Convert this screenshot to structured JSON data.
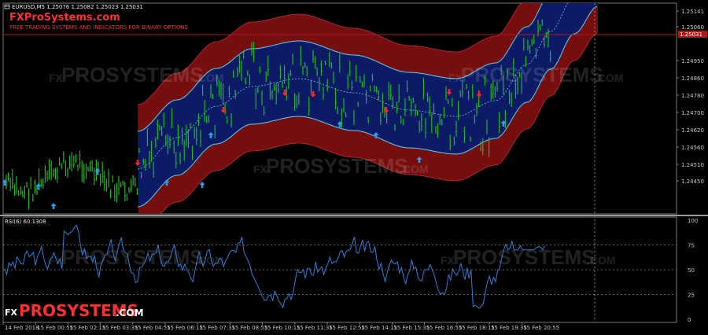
{
  "main_chart": {
    "symbol_info": "EURUSD,M5  1.25076 1.25082 1.25023 1.25031",
    "price_axis": [
      "1.25141",
      "1.25060",
      "1.24950",
      "1.24860",
      "1.24780",
      "1.24700",
      "1.24620",
      "1.24560",
      "1.24510",
      "1.24450"
    ],
    "current_price": "1.25031",
    "brand_title": "FXProSystems.com",
    "brand_subtitle": "FREE TRADING SYSTEMS AND INDICATORS FOR BINARY OPTIONS",
    "watermark_small": "FX",
    "watermark_big": "PROSYSTEMS",
    "watermark_suffix": ".COM"
  },
  "rsi_panel": {
    "label": "RSI(6) 60.1308",
    "levels": [
      "100",
      "75",
      "50",
      "25",
      "0"
    ]
  },
  "time_axis": [
    "14 Feb 2018",
    "15 Feb 00:55",
    "15 Feb 02:15",
    "15 Feb 03:35",
    "15 Feb 04:55",
    "15 Feb 06:15",
    "15 Feb 07:35",
    "15 Feb 08:55",
    "15 Feb 10:15",
    "15 Feb 11:35",
    "15 Feb 12:55",
    "15 Feb 14:15",
    "15 Feb 15:35",
    "15 Feb 16:55",
    "15 Feb 18:15",
    "15 Feb 19:35",
    "15 Feb 20:55"
  ],
  "footer_logo": {
    "fx": "FX",
    "main": "PROSYSTEMS",
    "suffix": ".COM"
  },
  "colors": {
    "candles": "#1fc21f",
    "rsi_line": "#2f7fd8",
    "up_arrow": "#2a9df4",
    "down_arrow": "#ff2222",
    "price_line": "#b01818",
    "outer_band": "#8b0f12",
    "inner_band": "#0d1a66",
    "band_edge": "#58d6ee",
    "brand_red": "#ff3030"
  },
  "icons": [
    "chart-window-icon",
    "up-arrow-icon",
    "down-arrow-icon"
  ]
}
